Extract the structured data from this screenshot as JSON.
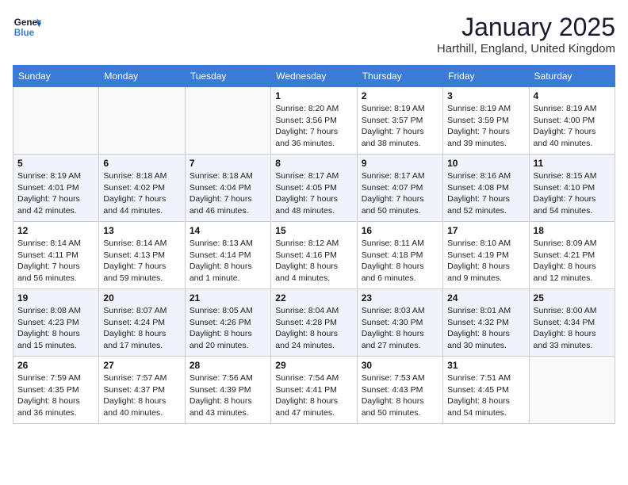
{
  "logo": {
    "line1": "General",
    "line2": "Blue"
  },
  "title": "January 2025",
  "location": "Harthill, England, United Kingdom",
  "days_of_week": [
    "Sunday",
    "Monday",
    "Tuesday",
    "Wednesday",
    "Thursday",
    "Friday",
    "Saturday"
  ],
  "weeks": [
    [
      {
        "day": "",
        "info": ""
      },
      {
        "day": "",
        "info": ""
      },
      {
        "day": "",
        "info": ""
      },
      {
        "day": "1",
        "info": "Sunrise: 8:20 AM\nSunset: 3:56 PM\nDaylight: 7 hours and 36 minutes."
      },
      {
        "day": "2",
        "info": "Sunrise: 8:19 AM\nSunset: 3:57 PM\nDaylight: 7 hours and 38 minutes."
      },
      {
        "day": "3",
        "info": "Sunrise: 8:19 AM\nSunset: 3:59 PM\nDaylight: 7 hours and 39 minutes."
      },
      {
        "day": "4",
        "info": "Sunrise: 8:19 AM\nSunset: 4:00 PM\nDaylight: 7 hours and 40 minutes."
      }
    ],
    [
      {
        "day": "5",
        "info": "Sunrise: 8:19 AM\nSunset: 4:01 PM\nDaylight: 7 hours and 42 minutes."
      },
      {
        "day": "6",
        "info": "Sunrise: 8:18 AM\nSunset: 4:02 PM\nDaylight: 7 hours and 44 minutes."
      },
      {
        "day": "7",
        "info": "Sunrise: 8:18 AM\nSunset: 4:04 PM\nDaylight: 7 hours and 46 minutes."
      },
      {
        "day": "8",
        "info": "Sunrise: 8:17 AM\nSunset: 4:05 PM\nDaylight: 7 hours and 48 minutes."
      },
      {
        "day": "9",
        "info": "Sunrise: 8:17 AM\nSunset: 4:07 PM\nDaylight: 7 hours and 50 minutes."
      },
      {
        "day": "10",
        "info": "Sunrise: 8:16 AM\nSunset: 4:08 PM\nDaylight: 7 hours and 52 minutes."
      },
      {
        "day": "11",
        "info": "Sunrise: 8:15 AM\nSunset: 4:10 PM\nDaylight: 7 hours and 54 minutes."
      }
    ],
    [
      {
        "day": "12",
        "info": "Sunrise: 8:14 AM\nSunset: 4:11 PM\nDaylight: 7 hours and 56 minutes."
      },
      {
        "day": "13",
        "info": "Sunrise: 8:14 AM\nSunset: 4:13 PM\nDaylight: 7 hours and 59 minutes."
      },
      {
        "day": "14",
        "info": "Sunrise: 8:13 AM\nSunset: 4:14 PM\nDaylight: 8 hours and 1 minute."
      },
      {
        "day": "15",
        "info": "Sunrise: 8:12 AM\nSunset: 4:16 PM\nDaylight: 8 hours and 4 minutes."
      },
      {
        "day": "16",
        "info": "Sunrise: 8:11 AM\nSunset: 4:18 PM\nDaylight: 8 hours and 6 minutes."
      },
      {
        "day": "17",
        "info": "Sunrise: 8:10 AM\nSunset: 4:19 PM\nDaylight: 8 hours and 9 minutes."
      },
      {
        "day": "18",
        "info": "Sunrise: 8:09 AM\nSunset: 4:21 PM\nDaylight: 8 hours and 12 minutes."
      }
    ],
    [
      {
        "day": "19",
        "info": "Sunrise: 8:08 AM\nSunset: 4:23 PM\nDaylight: 8 hours and 15 minutes."
      },
      {
        "day": "20",
        "info": "Sunrise: 8:07 AM\nSunset: 4:24 PM\nDaylight: 8 hours and 17 minutes."
      },
      {
        "day": "21",
        "info": "Sunrise: 8:05 AM\nSunset: 4:26 PM\nDaylight: 8 hours and 20 minutes."
      },
      {
        "day": "22",
        "info": "Sunrise: 8:04 AM\nSunset: 4:28 PM\nDaylight: 8 hours and 24 minutes."
      },
      {
        "day": "23",
        "info": "Sunrise: 8:03 AM\nSunset: 4:30 PM\nDaylight: 8 hours and 27 minutes."
      },
      {
        "day": "24",
        "info": "Sunrise: 8:01 AM\nSunset: 4:32 PM\nDaylight: 8 hours and 30 minutes."
      },
      {
        "day": "25",
        "info": "Sunrise: 8:00 AM\nSunset: 4:34 PM\nDaylight: 8 hours and 33 minutes."
      }
    ],
    [
      {
        "day": "26",
        "info": "Sunrise: 7:59 AM\nSunset: 4:35 PM\nDaylight: 8 hours and 36 minutes."
      },
      {
        "day": "27",
        "info": "Sunrise: 7:57 AM\nSunset: 4:37 PM\nDaylight: 8 hours and 40 minutes."
      },
      {
        "day": "28",
        "info": "Sunrise: 7:56 AM\nSunset: 4:39 PM\nDaylight: 8 hours and 43 minutes."
      },
      {
        "day": "29",
        "info": "Sunrise: 7:54 AM\nSunset: 4:41 PM\nDaylight: 8 hours and 47 minutes."
      },
      {
        "day": "30",
        "info": "Sunrise: 7:53 AM\nSunset: 4:43 PM\nDaylight: 8 hours and 50 minutes."
      },
      {
        "day": "31",
        "info": "Sunrise: 7:51 AM\nSunset: 4:45 PM\nDaylight: 8 hours and 54 minutes."
      },
      {
        "day": "",
        "info": ""
      }
    ]
  ]
}
